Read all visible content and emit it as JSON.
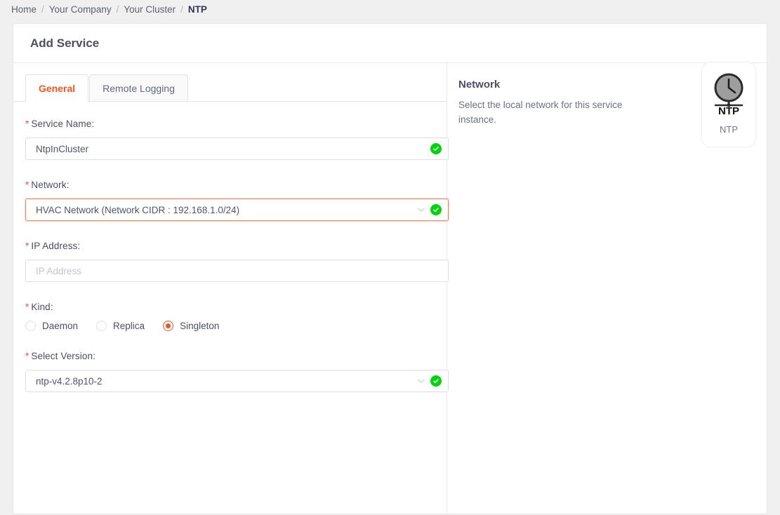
{
  "breadcrumb": {
    "items": [
      "Home",
      "Your Company",
      "Your Cluster",
      "NTP"
    ],
    "separator": "/"
  },
  "card": {
    "title": "Add Service"
  },
  "tabs": [
    {
      "label": "General",
      "active": true
    },
    {
      "label": "Remote Logging",
      "active": false
    }
  ],
  "form": {
    "service_name": {
      "label": "Service Name",
      "required_mark": "*",
      "colon": ":",
      "value": "NtpInCluster",
      "valid": true
    },
    "network": {
      "label": "Network",
      "required_mark": "*",
      "colon": ":",
      "value": "HVAC Network (Network CIDR : 192.168.1.0/24)",
      "valid": true,
      "focused": true
    },
    "ip_address": {
      "label": "IP Address",
      "required_mark": "*",
      "colon": ":",
      "value": "",
      "placeholder": "IP Address",
      "valid": false
    },
    "kind": {
      "label": "Kind",
      "required_mark": "*",
      "colon": ":",
      "options": [
        {
          "label": "Daemon",
          "selected": false
        },
        {
          "label": "Replica",
          "selected": false
        },
        {
          "label": "Singleton",
          "selected": true
        }
      ]
    },
    "select_version": {
      "label": "Select Version",
      "required_mark": "*",
      "colon": ":",
      "value": "ntp-v4.2.8p10-2",
      "valid": true
    }
  },
  "info_panel": {
    "title": "Network",
    "description": "Select the local network for this service instance."
  },
  "logo": {
    "icon_name": "ntp-clock-icon",
    "icon_text": "NTP",
    "caption": "NTP"
  },
  "colors": {
    "accent": "#f4541d",
    "required": "#f14668",
    "valid_green": "#00d40a",
    "focus_border": "#f0875c",
    "page_bg": "#f0f0f0"
  }
}
